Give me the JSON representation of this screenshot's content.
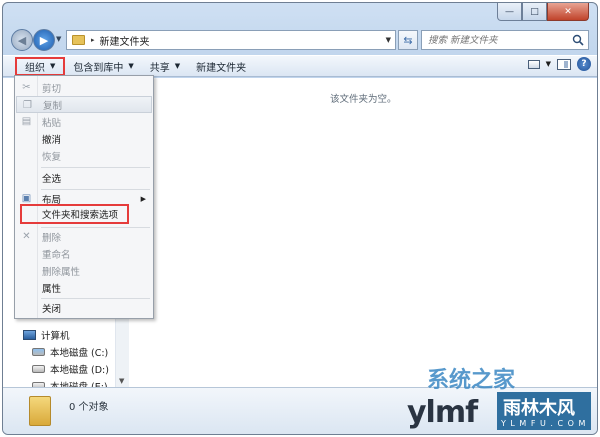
{
  "window": {
    "caption_min": "—",
    "caption_max": "□",
    "caption_close": "✕"
  },
  "address_bar": {
    "path": "新建文件夹",
    "separator": "▸",
    "search_placeholder": "搜索 新建文件夹"
  },
  "toolbar": {
    "organize": "组织",
    "include_library": "包含到库中",
    "share": "共享",
    "new_folder": "新建文件夹"
  },
  "content": {
    "empty_message": "该文件夹为空。"
  },
  "organize_menu": {
    "items": [
      {
        "label": "剪切",
        "disabled": true
      },
      {
        "label": "复制",
        "disabled": true
      },
      {
        "label": "粘贴",
        "disabled": true
      },
      {
        "label": "撤消",
        "disabled": false
      },
      {
        "label": "恢复",
        "disabled": true
      },
      {
        "label": "全选",
        "disabled": false
      },
      {
        "label": "布局",
        "disabled": false
      },
      {
        "label": "文件夹和搜索选项",
        "disabled": false
      },
      {
        "label": "删除",
        "disabled": true
      },
      {
        "label": "重命名",
        "disabled": true
      },
      {
        "label": "删除属性",
        "disabled": true
      },
      {
        "label": "属性",
        "disabled": false
      },
      {
        "label": "关闭",
        "disabled": false
      }
    ]
  },
  "nav_tree": {
    "computer": "计算机",
    "drives": [
      "本地磁盘 (C:)",
      "本地磁盘 (D:)",
      "本地磁盘 (E:)"
    ]
  },
  "status_bar": {
    "item_count": "0 个对象"
  },
  "watermark": {
    "brand_top": "系统之家",
    "brand_text": "ylmf",
    "badge_cn": "雨林木风",
    "badge_url": "Y L M F U . C O M"
  },
  "colors": {
    "highlight_box": "#e53b3b",
    "window_frame": "#bfd4ec"
  }
}
